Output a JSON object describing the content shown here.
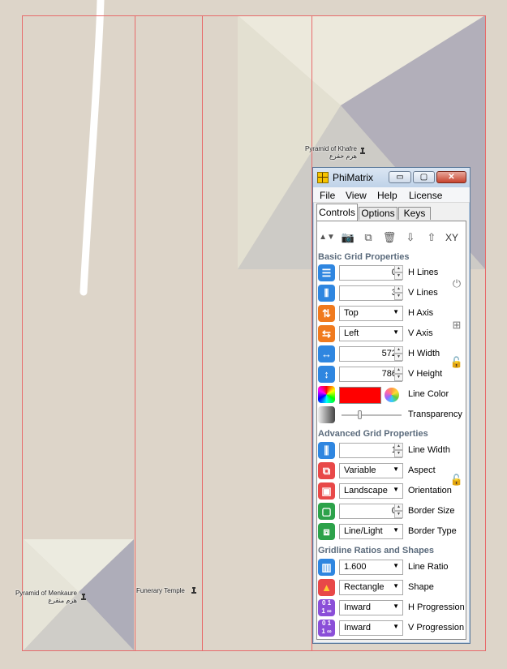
{
  "map": {
    "pois": [
      {
        "name": "Pyramid of Khafre",
        "name_ar": "هرم خفرع"
      },
      {
        "name": "Pyramid of Menkaure",
        "name_ar": "هرم منقرع"
      },
      {
        "name": "Funerary Temple",
        "name_ar": ""
      }
    ],
    "grid_color": "#e76b6b"
  },
  "window": {
    "title": "PhiMatrix",
    "min_label": "▭",
    "max_label": "▢",
    "close_label": "✕"
  },
  "menu": [
    "File",
    "View",
    "Help",
    "License"
  ],
  "tabs": [
    "Controls",
    "Options",
    "Keys"
  ],
  "toolbar": [
    "▲▼",
    "📷",
    "⧉",
    "🗑",
    "⇩",
    "⇧",
    "XY"
  ],
  "basic": {
    "heading": "Basic Grid Properties",
    "h_lines": {
      "value": "0",
      "label": "H Lines"
    },
    "v_lines": {
      "value": "3",
      "label": "V Lines"
    },
    "h_axis": {
      "value": "Top",
      "label": "H Axis"
    },
    "v_axis": {
      "value": "Left",
      "label": "V Axis"
    },
    "h_width": {
      "value": "572",
      "label": "H Width"
    },
    "v_height": {
      "value": "786",
      "label": "V Height"
    },
    "line_color": {
      "value": "#ff0000",
      "label": "Line Color"
    },
    "transparency": {
      "label": "Transparency",
      "level": 0.3
    }
  },
  "advanced": {
    "heading": "Advanced Grid Properties",
    "line_width": {
      "value": "1",
      "label": "Line Width"
    },
    "aspect": {
      "value": "Variable",
      "label": "Aspect"
    },
    "orientation": {
      "value": "Landscape",
      "label": "Orientation"
    },
    "border_size": {
      "value": "0",
      "label": "Border Size"
    },
    "border_type": {
      "value": "Line/Light",
      "label": "Border Type"
    }
  },
  "ratios": {
    "heading": "Gridline Ratios and Shapes",
    "line_ratio": {
      "value": "1.600",
      "label": "Line Ratio"
    },
    "shape": {
      "value": "Rectangle",
      "label": "Shape"
    },
    "h_progression": {
      "value": "Inward",
      "label": "H Progression"
    },
    "v_progression": {
      "value": "Inward",
      "label": "V Progression"
    }
  }
}
